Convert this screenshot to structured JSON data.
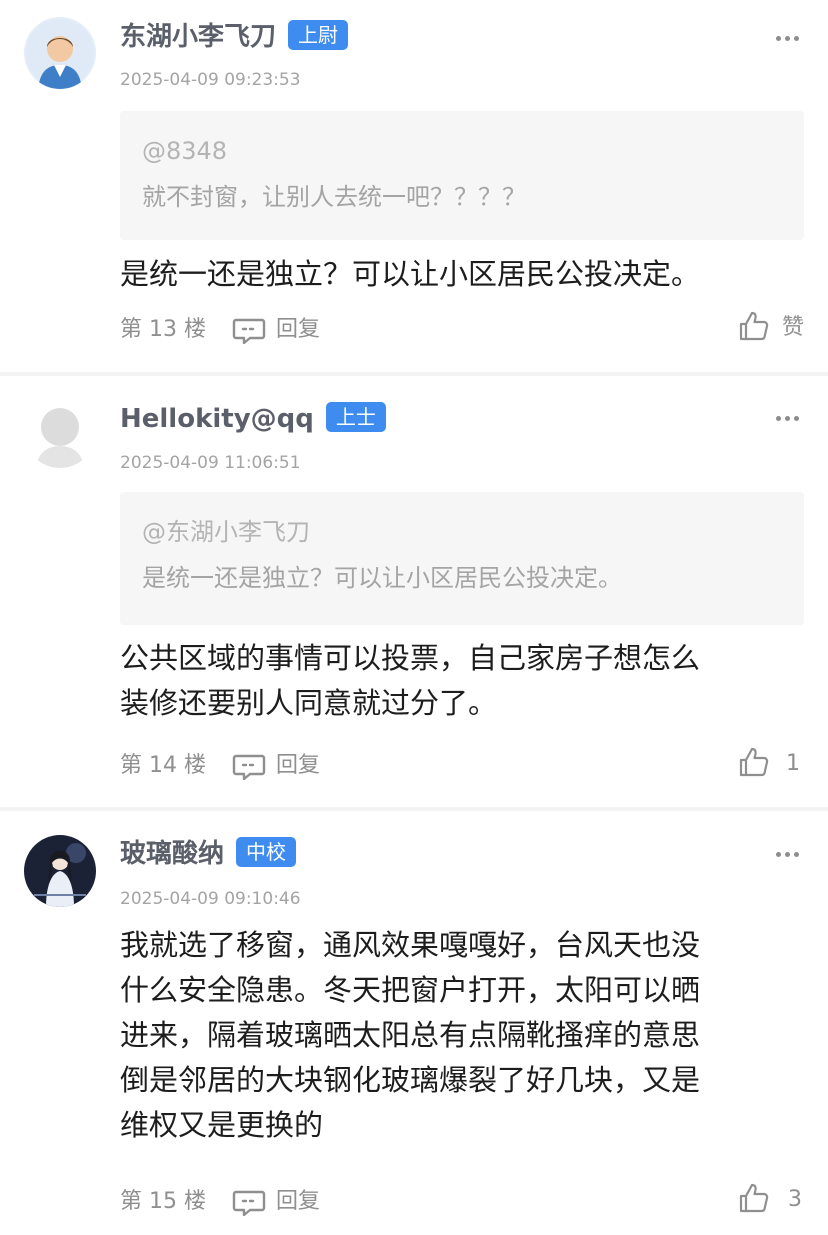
{
  "comments": [
    {
      "username": "东湖小李飞刀",
      "rank": "上尉",
      "time": "2025-04-09 09:23:53",
      "quote_at": "@8348",
      "quote_text": "就不封窗，让别人去统一吧？？？？",
      "body_lines": [
        "是统一还是独立？可以让小区居民公投决定。"
      ],
      "floor": "第 13 楼",
      "reply_label": "回复",
      "like_label": "赞"
    },
    {
      "username": "Hellokity@qq",
      "rank": "上士",
      "time": "2025-04-09 11:06:51",
      "quote_at": "@东湖小李飞刀",
      "quote_text": "是统一还是独立？可以让小区居民公投决定。",
      "body_lines": [
        "公共区域的事情可以投票，自己家房子想怎么",
        "装修还要别人同意就过分了。"
      ],
      "floor": "第 14 楼",
      "reply_label": "回复",
      "like_label": "1"
    },
    {
      "username": "玻璃酸纳",
      "rank": "中校",
      "time": "2025-04-09 09:10:46",
      "body_lines": [
        "我就选了移窗，通风效果嘎嘎好，台风天也没",
        "什么安全隐患。冬天把窗户打开，太阳可以晒",
        "进来，隔着玻璃晒太阳总有点隔靴搔痒的意思",
        "倒是邻居的大块钢化玻璃爆裂了好几块，又是",
        "维权又是更换的"
      ],
      "floor": "第 15 楼",
      "reply_label": "回复",
      "like_label": "3"
    }
  ],
  "colors": {
    "rank_badge": "#3f8cf0",
    "username": "#5a5f6a",
    "quote_bg": "#f6f6f6",
    "separator": "#f3f3f3"
  },
  "icons": {
    "more": "more-dots-icon",
    "reply": "comment-bubble-icon",
    "like": "thumbs-up-icon"
  }
}
